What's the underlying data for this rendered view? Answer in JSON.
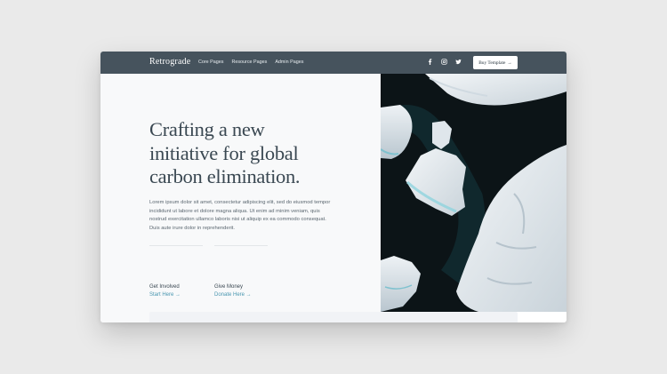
{
  "navbar": {
    "brand": "Retrograde",
    "links": [
      "Core Pages",
      "Resource Pages",
      "Admin Pages"
    ],
    "socials": [
      "facebook-icon",
      "instagram-icon",
      "twitter-icon"
    ],
    "buy_button": "Buy Template",
    "buy_arrow": "→"
  },
  "hero": {
    "headline_lines": [
      "Crafting a new",
      "initiative for global",
      "carbon elimination."
    ],
    "body": "Lorem ipsum dolor sit amet, consectetur adipiscing elit, sed do eiusmod tempor incididunt ut labore et dolore magna aliqua. Ut enim ad minim veniam, quis nostrud exercitation ullamco laboris nisi ut aliquip ex ea commodo consequat. Duis aute irure dolor in reprehenderit.",
    "ctas": [
      {
        "label": "Get Involved",
        "link": "Start Here →"
      },
      {
        "label": "Give Money",
        "link": "Donate Here →"
      }
    ]
  },
  "colors": {
    "page_bg": "#eaeaea",
    "navbar": "#46535d",
    "heading": "#3a4852",
    "link": "#4a97b0",
    "ocean": "#0c1417",
    "ice": "#e9eef2"
  }
}
